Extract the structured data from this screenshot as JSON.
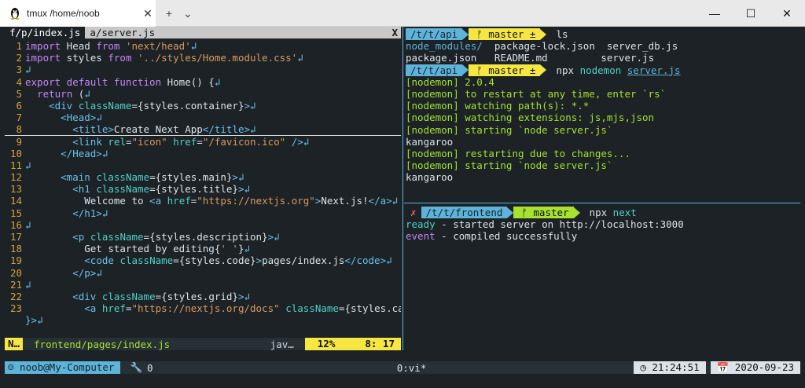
{
  "window": {
    "tab_title": "tmux  /home/noob",
    "tab_close": "✕",
    "new_tab": "+",
    "dropdown": "⌄",
    "minimize": "—",
    "maximize": "☐",
    "close": "✕"
  },
  "editor": {
    "buffers": {
      "current": "f/p/index.js",
      "other": "a/server.js",
      "close": "X"
    },
    "status": {
      "mode": "N…",
      "path": "frontend/pages/index.js",
      "filetype": "jav…",
      "percent": "12%",
      "position": "8: 17"
    }
  },
  "right_top": {
    "prompt1": {
      "path": "/t/t/api",
      "git": "ᚠ master ±",
      "cmd": "ls"
    },
    "ls_row1": [
      "node_modules/",
      "package-lock.json",
      "server_db.js"
    ],
    "ls_row2": [
      "package.json",
      "README.md",
      "server.js"
    ],
    "prompt2": {
      "path": "/t/t/api",
      "git": "ᚠ master ±",
      "cmd_a": "npx",
      "cmd_b": "nodemon",
      "cmd_c": "server.js"
    },
    "out": [
      "[nodemon] 2.0.4",
      "[nodemon] to restart at any time, enter `rs`",
      "[nodemon] watching path(s): *.*",
      "[nodemon] watching extensions: js,mjs,json",
      "[nodemon] starting `node server.js`",
      "kangaroo",
      "[nodemon] restarting due to changes...",
      "[nodemon] starting `node server.js`",
      "kangaroo"
    ]
  },
  "right_bottom": {
    "mark": "✗",
    "path": "/t/t/frontend",
    "git": "ᚠ master",
    "cmd_a": "npx",
    "cmd_b": "next",
    "line1_key": "ready",
    "line1_rest": " - started server on http://localhost:3000",
    "line2_key": "event",
    "line2_rest": " - compiled successfully"
  },
  "tmux": {
    "user": "☺ noob@My-Computer",
    "wrench": "🔧",
    "count": "0",
    "window": "0:vi*",
    "time": "◷ 21:24:51",
    "date_icon": "📅",
    "date": "2020-09-23"
  },
  "colors": {
    "background": "#1c2226",
    "accent_blue": "#5fb3d9",
    "accent_yellow": "#f5e642",
    "accent_green": "#a6e22e"
  }
}
